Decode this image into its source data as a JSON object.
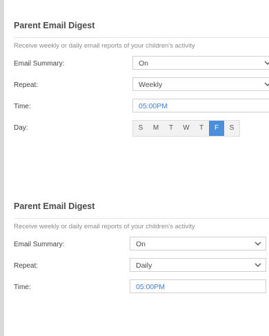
{
  "digest_top": {
    "title": "Parent Email Digest",
    "description": "Receive weekly or daily email reports of your children's activity",
    "email_summary_label": "Email Summary:",
    "email_summary_value": "On",
    "repeat_label": "Repeat:",
    "repeat_value": "Weekly",
    "time_label": "Time:",
    "time_value": "05:00PM",
    "day_label": "Day:",
    "days": [
      "S",
      "M",
      "T",
      "W",
      "T",
      "F",
      "S"
    ],
    "selected_day_index": 5
  },
  "digest_bottom": {
    "title": "Parent Email Digest",
    "description": "Receive weekly or daily email reports of your children's activity",
    "email_summary_label": "Email Summary:",
    "email_summary_value": "On",
    "repeat_label": "Repeat:",
    "repeat_value": "Daily",
    "time_label": "Time:",
    "time_value": "05:00PM"
  },
  "colors": {
    "accent": "#4a8fdb",
    "time_text": "#3f7fcf"
  },
  "icons": {
    "dropdown": "chevron-down-icon"
  }
}
